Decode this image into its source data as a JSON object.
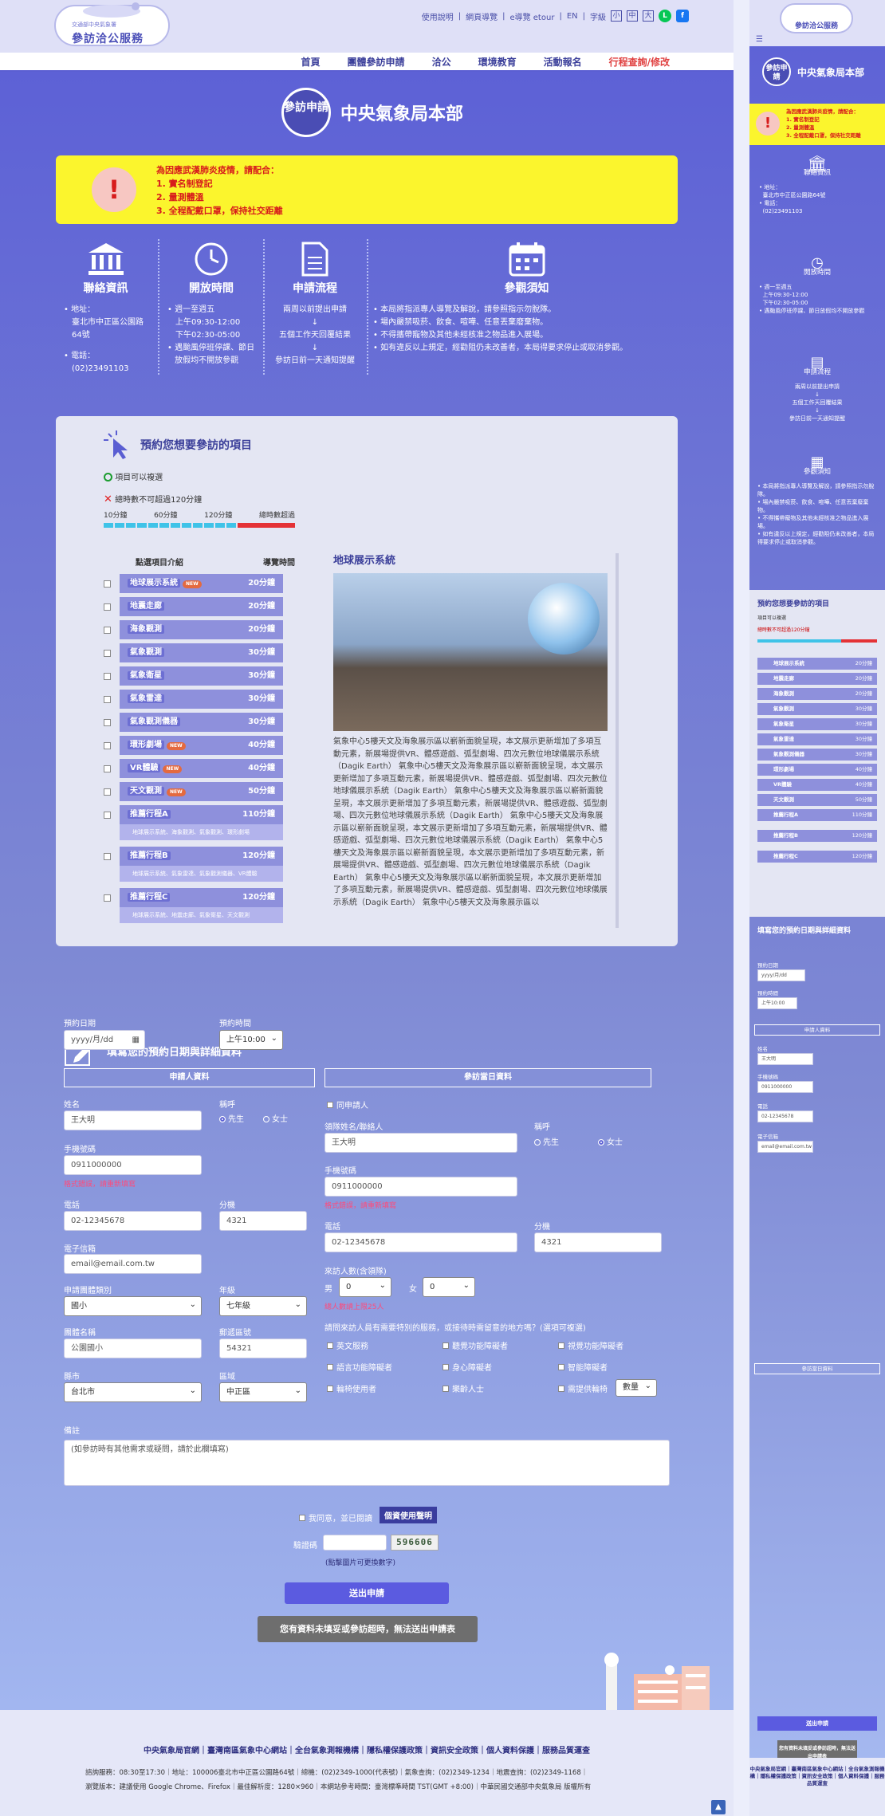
{
  "site": {
    "logo_small": "交通部中央氣象署",
    "logo_main": "參訪洽公服務"
  },
  "toplinks": [
    "使用說明",
    "網頁導覽",
    "e導覽 etour",
    "EN",
    "字級"
  ],
  "font_sizes": [
    "小",
    "中",
    "大"
  ],
  "social": [
    {
      "icon": "line-icon",
      "label": "L",
      "color": "#06c755"
    },
    {
      "icon": "facebook-icon",
      "label": "f",
      "color": "#1877f2"
    }
  ],
  "nav": [
    "首頁",
    "團體參訪申請",
    "洽公",
    "環境教育",
    "活動報名",
    "行程查詢/修改"
  ],
  "page_title": {
    "badge": "參訪申請",
    "name": "中央氣象局本部"
  },
  "alert": {
    "intro": "為因應武漢肺炎疫情，請配合：",
    "items": [
      "1. 實名制登記",
      "2. 量測體溫",
      "3. 全程配戴口罩，保持社交距離"
    ]
  },
  "info": {
    "contact": {
      "title": "聯絡資訊",
      "address_label": "地址：",
      "address": "臺北市中正區公園路64號",
      "phone_label": "電話：",
      "phone": "(02)23491103"
    },
    "hours": {
      "title": "開放時間",
      "items": [
        "週一至週五",
        "上午09:30-12:00",
        "下午02:30-05:00",
        "遇颱風停班停課、節日放假均不開放參觀"
      ]
    },
    "process": {
      "title": "申請流程",
      "steps": [
        "兩周以前提出申請",
        "↓",
        "五個工作天回覆結果",
        "↓",
        "參訪日前一天通知提醒"
      ]
    },
    "notes": {
      "title": "參觀須知",
      "items": [
        "本局將指派專人導覽及解說，請參照指示勿脫隊。",
        "場內嚴禁吸菸、飲食、喧嘩、任意丟棄廢棄物。",
        "不得攜帶寵物及其他未經核准之物品進入展場。",
        "如有違反以上規定，經勸阻仍未改善者，本局得要求停止或取消參觀。"
      ]
    }
  },
  "projects": {
    "title": "預約您想要參訪的項目",
    "legend_ok": "項目可以複選",
    "legend_limit": "總時數不可超過120分鐘",
    "scale": [
      "10分鐘",
      "60分鐘",
      "120分鐘",
      "總時數超過"
    ],
    "col_item": "點選項目介紹",
    "col_time": "導覽時間",
    "items": [
      {
        "name": "地球展示系統",
        "time": "20分鐘",
        "tag": "NEW"
      },
      {
        "name": "地震走廊",
        "time": "20分鐘",
        "tag": ""
      },
      {
        "name": "海象觀測",
        "time": "20分鐘",
        "tag": ""
      },
      {
        "name": "氣象觀測",
        "time": "30分鐘",
        "tag": ""
      },
      {
        "name": "氣象衛星",
        "time": "30分鐘",
        "tag": ""
      },
      {
        "name": "氣象雷達",
        "time": "30分鐘",
        "tag": ""
      },
      {
        "name": "氣象觀測儀器",
        "time": "30分鐘",
        "tag": ""
      },
      {
        "name": "環形劇場",
        "time": "40分鐘",
        "tag": "NEW"
      },
      {
        "name": "VR體驗",
        "time": "40分鐘",
        "tag": "NEW"
      },
      {
        "name": "天文觀測",
        "time": "50分鐘",
        "tag": "NEW"
      },
      {
        "name": "推薦行程A",
        "time": "110分鐘",
        "sub": "地球展示系統、海象觀測、氣象觀測、環形劇場"
      },
      {
        "name": "推薦行程B",
        "time": "120分鐘",
        "sub": "地球展示系統、氣象雷達、氣象觀測儀器、VR體驗"
      },
      {
        "name": "推薦行程C",
        "time": "120分鐘",
        "sub": "地球展示系統、地震走廊、氣象衛星、天文觀測"
      }
    ],
    "preview_title": "地球展示系統",
    "preview_text": "氣象中心5樓天文及海象展示區以嶄新面貌呈現，本文展示更新增加了多項互動元素，新展場提供VR、體感遊戲、弧型劇場、四次元數位地球儀展示系統（Dagik Earth） 氣象中心5樓天文及海象展示區以嶄新面貌呈現，本文展示更新增加了多項互動元素，新展場提供VR、體感遊戲、弧型劇場、四次元數位地球儀展示系統（Dagik Earth） 氣象中心5樓天文及海象展示區以嶄新面貌呈現，本文展示更新增加了多項互動元素，新展場提供VR、體感遊戲、弧型劇場、四次元數位地球儀展示系統（Dagik Earth） 氣象中心5樓天文及海象展示區以嶄新面貌呈現，本文展示更新增加了多項互動元素，新展場提供VR、體感遊戲、弧型劇場、四次元數位地球儀展示系統（Dagik Earth） 氣象中心5樓天文及海象展示區以嶄新面貌呈現，本文展示更新增加了多項互動元素，新展場提供VR、體感遊戲、弧型劇場、四次元數位地球儀展示系統（Dagik Earth） 氣象中心5樓天文及海象展示區以嶄新面貌呈現，本文展示更新增加了多項互動元素，新展場提供VR、體感遊戲、弧型劇場、四次元數位地球儀展示系統（Dagik Earth） 氣象中心5樓天文及海象展示區以"
  },
  "form": {
    "title": "填寫您的預約日期與詳細資料",
    "date_label": "預約日期",
    "date_placeholder": "yyyy/月/dd",
    "time_label": "預約時間",
    "time_value": "上午10:00",
    "applicant_header": "申請人資料",
    "visit_header": "參訪當日資料",
    "name_label": "姓名",
    "name_ph": "王大明",
    "title_label": "稱呼",
    "male": "先生",
    "female": "女士",
    "mobile_label": "手機號碼",
    "mobile_ph": "0911000000",
    "mobile_hint": "格式錯誤，請重新填寫",
    "phone_label": "電話",
    "phone_ph": "02-12345678",
    "ext_label": "分機",
    "ext_ph": "4321",
    "email_label": "電子信箱",
    "email_ph": "email@email.com.tw",
    "org_type_label": "申請團體類別",
    "org_type": "國小",
    "grade_label": "年級",
    "grade": "七年級",
    "org_name_label": "團體名稱",
    "org_name_ph": "公園國小",
    "zip_label": "郵遞區號",
    "zip_ph": "54321",
    "city_label": "縣市",
    "city": "台北市",
    "district_label": "區域",
    "district": "中正區",
    "same_as": "同申請人",
    "leader_label": "領隊姓名/聯絡人",
    "leader_ph": "王大明",
    "count_label": "來訪人數(含領隊)",
    "male_short": "男",
    "female_short": "女",
    "count_value": "0",
    "count_hint": "總人數請上限25人",
    "special_q": "請問來訪人員有需要特別的服務，或接待時需留意的地方嗎？(選項可複選)",
    "special": [
      "英文服務",
      "聽覺功能障礙者",
      "視覺功能障礙者",
      "語言功能障礙者",
      "身心障礙者",
      "智能障礙者",
      "輪椅使用者",
      "樂齡人士",
      "需提供輪椅"
    ],
    "qty": "數量",
    "remark_label": "備註",
    "remark_ph": "(如參訪時有其他需求或疑問，請於此欄填寫)",
    "agree": "我同意，並已閱讀",
    "privacy": "個資使用聲明",
    "captcha_label": "驗證碼",
    "captcha": "596606",
    "captcha_hint": "(點擊圖片可更換數字)",
    "submit": "送出申請",
    "notice": "您有資料未填妥或參訪超時，無法送出申請表"
  },
  "footer": {
    "links": "中央氣象局官網｜臺灣南區氣象中心網站｜全台氣象測報機構｜隱私權保護政策｜資訊安全政策｜個人資料保護｜服務品質運查",
    "line2": "諮詢服務：08:30至17:30｜地址：100006臺北市中正區公園路64號｜總機：(02)2349-1000(代表號)｜氣象查詢：(02)2349-1234｜地震查詢：(02)2349-1168｜",
    "line3": "瀏覽版本：建議使用 Google Chrome、Firefox｜最佳解析度：1280×960｜本網站參考時間：臺灣標準時間 TST(GMT +8:00)｜中華民國交通部中央氣象局 版權所有"
  },
  "mobile": {
    "logo": "參訪洽公服務",
    "badge": "參訪申請",
    "title": "中央氣象局本部",
    "contact": "聯絡資訊",
    "hours": "開放時間",
    "process": "申請流程",
    "notes": "參觀須知",
    "proj_title": "預約您想要參訪的項目",
    "form_title": "填寫您的預約日期與詳細資料",
    "submit": "送出申請",
    "notice": "您有資料未填妥或參訪超時，無法送出申請表"
  }
}
